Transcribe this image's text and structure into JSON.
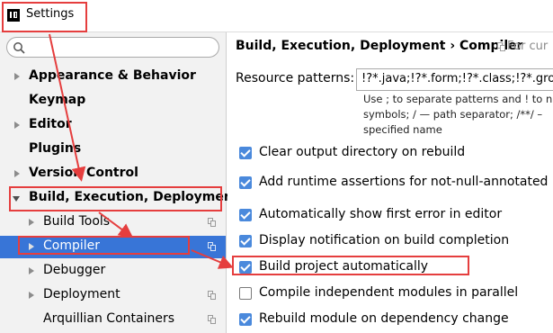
{
  "window": {
    "title": "Settings"
  },
  "search": {
    "value": "",
    "placeholder": ""
  },
  "sidebar": {
    "items": [
      {
        "label": "Appearance & Behavior",
        "bold": true
      },
      {
        "label": "Keymap",
        "bold": true
      },
      {
        "label": "Editor",
        "bold": true
      },
      {
        "label": "Plugins",
        "bold": true
      },
      {
        "label": "Version Control",
        "bold": true
      },
      {
        "label": "Build, Execution, Deployment",
        "bold": true,
        "expanded": true
      },
      {
        "label": "Build Tools"
      },
      {
        "label": "Compiler",
        "selected": true
      },
      {
        "label": "Debugger"
      },
      {
        "label": "Deployment"
      },
      {
        "label": "Arquillian Containers"
      }
    ]
  },
  "main": {
    "breadcrumb": "Build, Execution, Deployment › Compiler",
    "breadcrumb_note": "For cur",
    "resource_patterns": {
      "label": "Resource patterns:",
      "value": "!?*.java;!?*.form;!?*.class;!?*.groov",
      "help_line1": "Use ; to separate patterns and ! to n",
      "help_line2": "symbols; / — path separator; /**/ –",
      "help_line3": "specified name"
    },
    "options": [
      {
        "label": "Clear output directory on rebuild",
        "checked": true
      },
      {
        "label": "Add runtime assertions for not-null-annotated m",
        "checked": true
      },
      {
        "label": "Automatically show first error in editor",
        "checked": true
      },
      {
        "label": "Display notification on build completion",
        "checked": true
      },
      {
        "label": "Build project automatically",
        "checked": true
      },
      {
        "label": "Compile independent modules in parallel",
        "checked": false
      },
      {
        "label": "Rebuild module on dependency change",
        "checked": true
      }
    ]
  },
  "colors": {
    "selection": "#3875d7",
    "checkbox": "#4a89dc",
    "annotation": "#e53e3e"
  }
}
